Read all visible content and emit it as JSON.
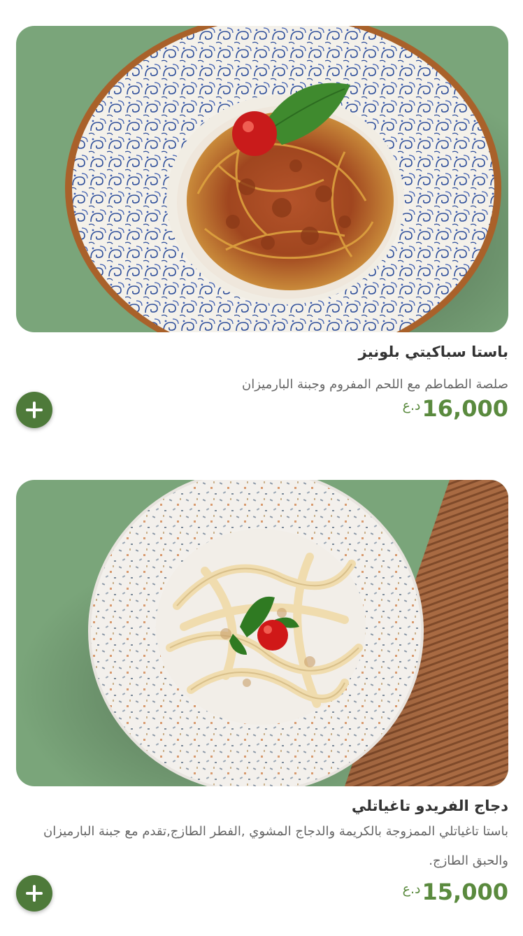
{
  "menu_items": [
    {
      "title": "باستا سباكيتي بلونيز",
      "description": "صلصة الطماطم مع اللحم المفروم وجبنة البارميزان",
      "price": "16,000",
      "currency": "د.ع",
      "image_icon": "spaghetti-bolognese-photo",
      "add_icon": "plus-icon"
    },
    {
      "title": "دجاج الفريدو تاغياتلي",
      "description": "باستا تاغياتلي الممزوجة بالكريمة والدجاج المشوي ,الفطر الطازج,تقدم مع جبنة البارميزان والحبق الطازج.",
      "price": "15,000",
      "currency": "د.ع",
      "image_icon": "chicken-alfredo-tagliatelle-photo",
      "add_icon": "plus-icon"
    }
  ],
  "colors": {
    "accent": "#4e7a3a",
    "price": "#5a8a3e",
    "title": "#333333",
    "description": "#666666",
    "photo_background": "#7aa57a"
  }
}
